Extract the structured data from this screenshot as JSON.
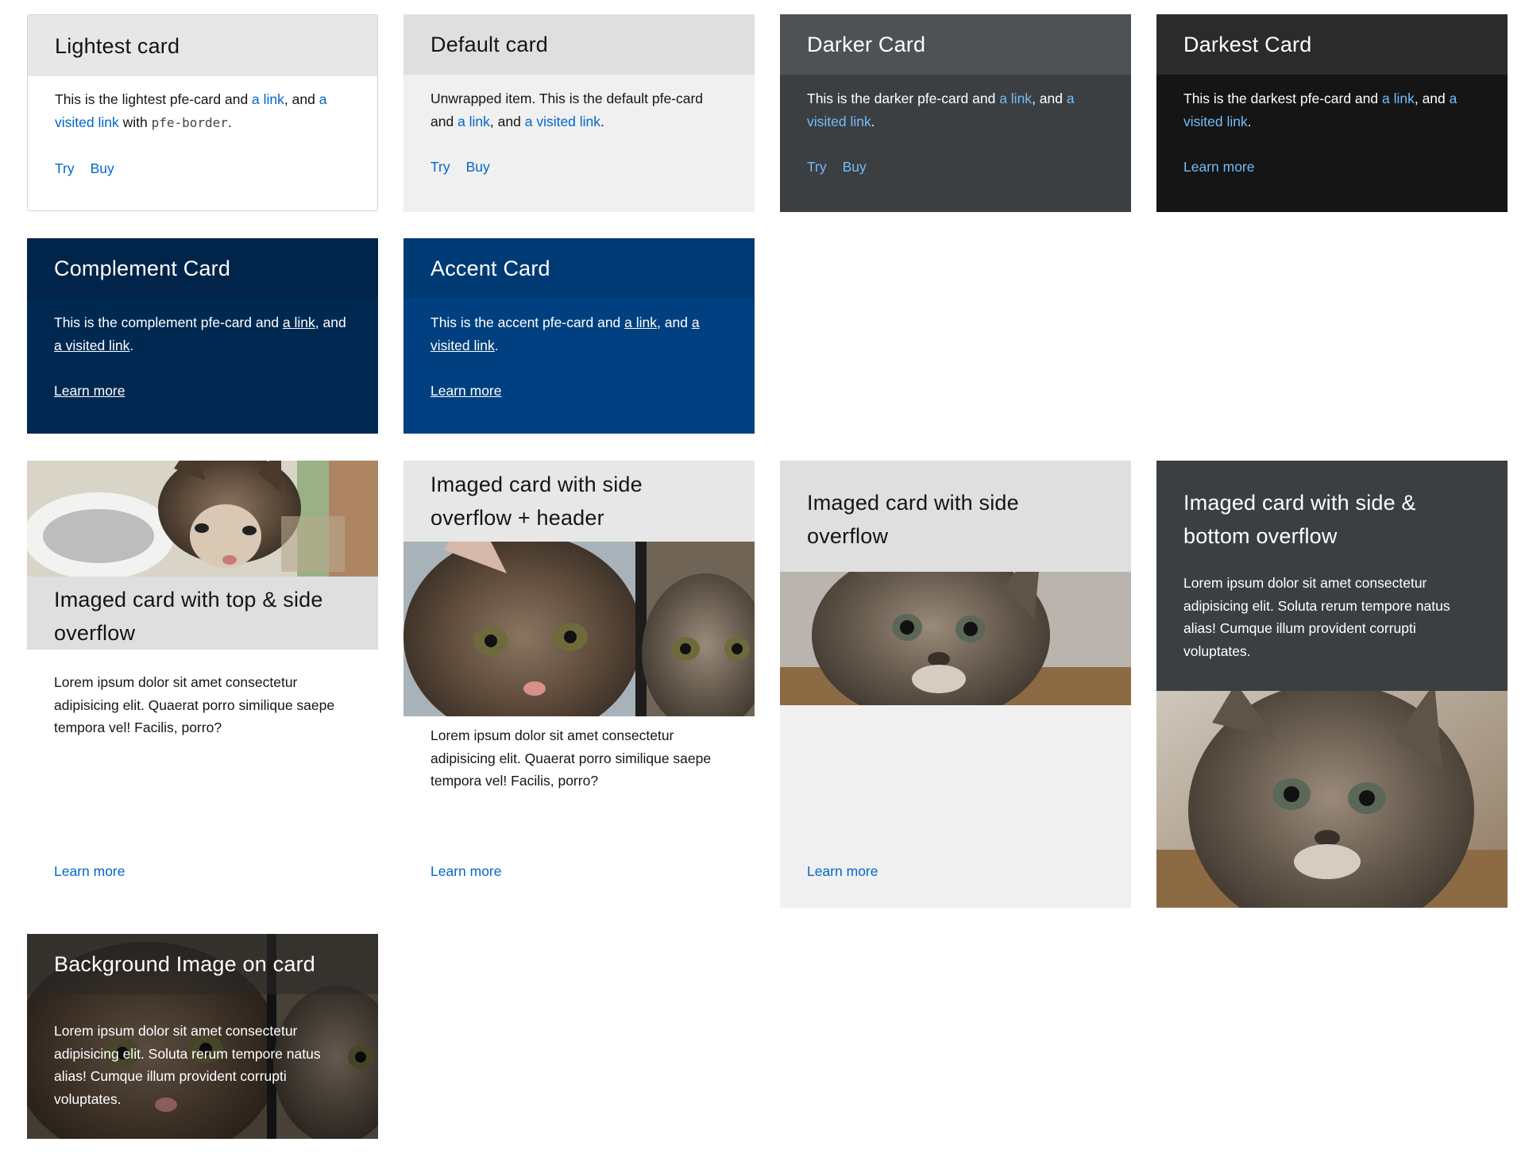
{
  "colors": {
    "link_blue": "#0066cc",
    "link_light_blue": "#73bcf7",
    "complement_bg": "#002952",
    "accent_bg": "#004080",
    "darker_bg": "#3c3f42",
    "darkest_bg": "#151515"
  },
  "cards": {
    "lightest": {
      "title": "Lightest card",
      "text_1": "This is the lightest pfe-card and ",
      "link_1": "a link",
      "text_2": ", and ",
      "link_2": "a visited link",
      "text_3": " with ",
      "code": "pfe-border",
      "text_4": ".",
      "actions": [
        "Try",
        "Buy"
      ]
    },
    "default": {
      "title": "Default card",
      "text_1": "Unwrapped item. This is the default pfe-card and ",
      "link_1": "a link",
      "text_2": ", and ",
      "link_2": "a visited link",
      "text_3": ".",
      "actions": [
        "Try",
        "Buy"
      ]
    },
    "darker": {
      "title": "Darker Card",
      "text_1": "This is the darker pfe-card and ",
      "link_1": "a link",
      "text_2": ", and ",
      "link_2": "a visited link",
      "text_3": ".",
      "actions": [
        "Try",
        "Buy"
      ]
    },
    "darkest": {
      "title": "Darkest Card",
      "text_1": "This is the darkest pfe-card and ",
      "link_1": "a link",
      "text_2": ", and ",
      "link_2": "a visited link",
      "text_3": ".",
      "action": "Learn more"
    },
    "complement": {
      "title": "Complement Card",
      "text_1": "This is the complement pfe-card and ",
      "link_1": "a link",
      "text_2": ", and ",
      "link_2": "a visited link",
      "text_3": ".",
      "action": "Learn more"
    },
    "accent": {
      "title": "Accent Card",
      "text_1": "This is the accent pfe-card and ",
      "link_1": "a link",
      "text_2": ", and ",
      "link_2": "a visited link",
      "text_3": ".",
      "action": "Learn more"
    },
    "imaged_top_side": {
      "title": "Imaged card with top & side overflow",
      "body": "Lorem ipsum dolor sit amet consectetur adipisicing elit. Quaerat porro similique saepe tempora vel! Facilis, porro?",
      "action": "Learn more"
    },
    "imaged_side_header": {
      "title": "Imaged card with side overflow + header",
      "body": "Lorem ipsum dolor sit amet consectetur adipisicing elit. Quaerat porro similique saepe tempora vel! Facilis, porro?",
      "action": "Learn more"
    },
    "imaged_side": {
      "title": "Imaged card with side overflow",
      "action": "Learn more"
    },
    "imaged_side_bottom": {
      "title": "Imaged card with side & bottom overflow",
      "body": "Lorem ipsum dolor sit amet consectetur adipisicing elit. Soluta rerum tempore natus alias! Cumque illum provident corrupti voluptates."
    },
    "background_image": {
      "title": "Background Image on card",
      "body": "Lorem ipsum dolor sit amet consectetur adipisicing elit. Soluta rerum tempore natus alias! Cumque illum provident corrupti voluptates."
    }
  }
}
